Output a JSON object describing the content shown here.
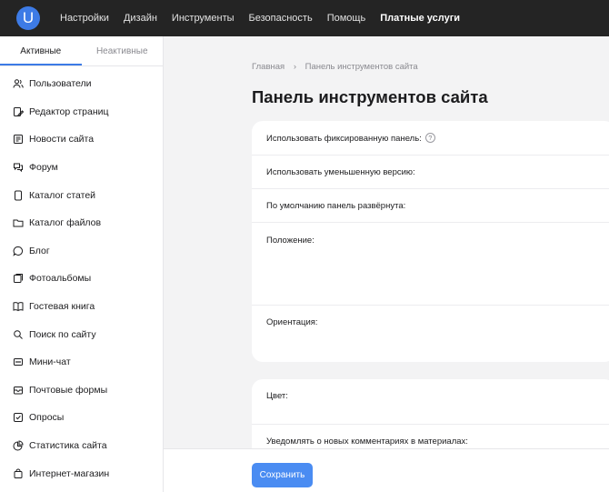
{
  "header": {
    "logo": "U",
    "nav": [
      {
        "label": "Настройки",
        "bold": false
      },
      {
        "label": "Дизайн",
        "bold": false
      },
      {
        "label": "Инструменты",
        "bold": false
      },
      {
        "label": "Безопасность",
        "bold": false
      },
      {
        "label": "Помощь",
        "bold": false
      },
      {
        "label": "Платные услуги",
        "bold": true
      }
    ]
  },
  "sidebar": {
    "tabs": {
      "active": "Активные",
      "inactive": "Неактивные"
    },
    "items": [
      {
        "label": "Пользователи",
        "icon": "users-icon"
      },
      {
        "label": "Редактор страниц",
        "icon": "page-editor-icon"
      },
      {
        "label": "Новости сайта",
        "icon": "news-icon"
      },
      {
        "label": "Форум",
        "icon": "forum-icon"
      },
      {
        "label": "Каталог статей",
        "icon": "articles-icon"
      },
      {
        "label": "Каталог файлов",
        "icon": "folder-icon"
      },
      {
        "label": "Блог",
        "icon": "blog-icon"
      },
      {
        "label": "Фотоальбомы",
        "icon": "photo-icon"
      },
      {
        "label": "Гостевая книга",
        "icon": "book-icon"
      },
      {
        "label": "Поиск по сайту",
        "icon": "search-icon"
      },
      {
        "label": "Мини-чат",
        "icon": "chat-icon"
      },
      {
        "label": "Почтовые формы",
        "icon": "mail-icon"
      },
      {
        "label": "Опросы",
        "icon": "poll-icon"
      },
      {
        "label": "Статистика сайта",
        "icon": "stats-icon"
      },
      {
        "label": "Интернет-магазин",
        "icon": "shop-icon"
      }
    ]
  },
  "main": {
    "breadcrumb": {
      "home": "Главная",
      "separator": "›",
      "current": "Панель инструментов сайта"
    },
    "title": "Панель инструментов сайта",
    "card1": [
      "Использовать фиксированную панель:",
      "Использовать уменьшенную версию:",
      "По умолчанию панель развёрнута:",
      "Положение:",
      "Ориентация:"
    ],
    "card2": [
      "Цвет:",
      "Уведомлять о новых комментариях в материалах:"
    ],
    "help_glyph": "?",
    "save_label": "Сохранить"
  },
  "colors": {
    "accent": "#3d7be6",
    "button": "#4a8cf2",
    "topbar": "#242424"
  }
}
